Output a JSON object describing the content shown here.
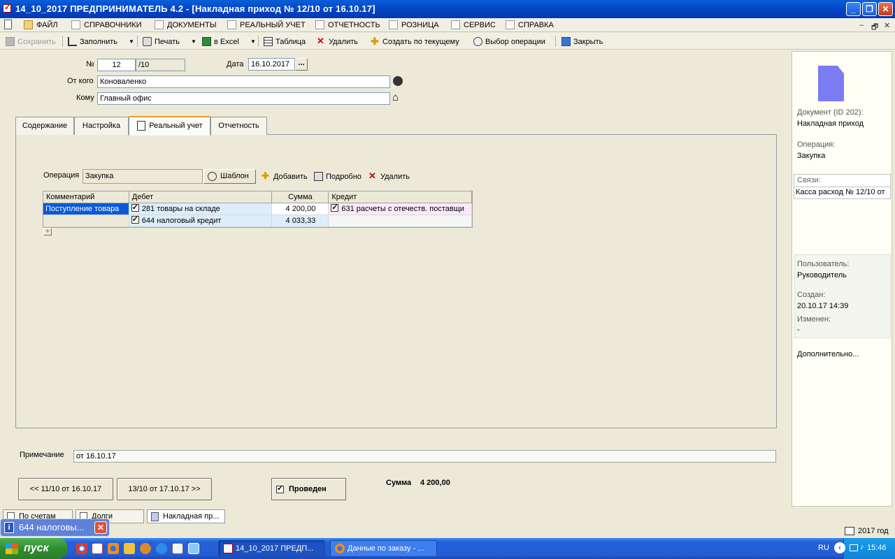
{
  "window": {
    "title": "14_10_2017  ПРЕДПРИНИМАТЕЛЬ 4.2 - [Накладная приход № 12/10 от 16.10.17]",
    "controls": {
      "minimize": "_",
      "maximize": "❐",
      "close": "✕"
    }
  },
  "menubar": {
    "items": [
      {
        "label": "ФАЙЛ",
        "icon": "folder-icon"
      },
      {
        "label": "СПРАВОЧНИКИ",
        "icon": "house-icon"
      },
      {
        "label": "ДОКУМЕНТЫ",
        "icon": "document-icon"
      },
      {
        "label": "РЕАЛЬНЫЙ УЧЕТ",
        "icon": "ledger-icon"
      },
      {
        "label": "ОТЧЕТНОСТЬ",
        "icon": "report-icon"
      },
      {
        "label": "РОЗНИЦА",
        "icon": "cash-register-icon"
      },
      {
        "label": "СЕРВИС",
        "icon": "service-icon"
      },
      {
        "label": "СПРАВКА",
        "icon": "help-icon"
      }
    ],
    "mdi_controls": {
      "minimize": "–",
      "restore": "🗗",
      "close": "✕"
    }
  },
  "toolbar": {
    "save": "Сохранить",
    "fill": "Заполнить",
    "print": "Печать",
    "excel": "в Excel",
    "table": "Таблица",
    "delete": "Удалить",
    "create_from_current": "Создать по текущему",
    "choose_operation": "Выбор операции",
    "close": "Закрыть"
  },
  "header_form": {
    "number_label": "№",
    "number_value": "12",
    "number_suffix": "/10",
    "date_label": "Дата",
    "date_value": "16.10.2017",
    "date_button": "...",
    "from_label": "От кого",
    "from_value": "Коноваленко",
    "to_label": "Кому",
    "to_value": "Главный офис"
  },
  "tabs": [
    {
      "label": "Содержание"
    },
    {
      "label": "Настройка"
    },
    {
      "label": "Реальный учет"
    },
    {
      "label": "Отчетность"
    }
  ],
  "operation_bar": {
    "label": "Операция",
    "value": "Закупка",
    "template_button": "Шаблон",
    "add_button": "Добавить",
    "details_button": "Подробно",
    "delete_button": "Удалить"
  },
  "entries_table": {
    "columns": [
      "Комментарий",
      "Дебет",
      "Сумма",
      "Кредит"
    ],
    "rows": [
      {
        "comment": "Поступление товара",
        "debit": "281 товары на складе",
        "amount": "4 200,00",
        "credit": "631  расчеты с  отечеств. поставщи"
      },
      {
        "comment": "",
        "debit": "644 налоговый кредит",
        "amount": "4 033,33",
        "credit": ""
      }
    ],
    "expand_button": "+"
  },
  "note": {
    "label": "Примечание",
    "value": "от 16.10.17"
  },
  "navigation": {
    "prev_button": "<< 11/10 от 16.10.17",
    "next_button": "13/10 от 17.10.17 >>"
  },
  "posted": {
    "label": "Проведен"
  },
  "total": {
    "label": "Сумма",
    "value": "4 200,00"
  },
  "right_panel": {
    "doc_label": "Документ  (ID 202):",
    "doc_value": "Накладная приход",
    "operation_label": "Операция:",
    "operation_value": "Закупка",
    "links_label": "Связи:",
    "links_value": "Касса расход № 12/10 от",
    "user_label": "Пользователь:",
    "user_value": "Руководитель",
    "created_label": "Создан:",
    "created_value": "20.10.17  14:39",
    "modified_label": "Изменен:",
    "modified_value": "-",
    "more": "Дополнительно..."
  },
  "window_tabs": [
    {
      "label": "По счетам"
    },
    {
      "label": "Долги"
    },
    {
      "label": "Накладная пр..."
    }
  ],
  "notification": {
    "text": "644 налоговы...",
    "close": "✕",
    "icon": "i"
  },
  "status": {
    "year": "2017 год"
  },
  "taskbar": {
    "start": "пуск",
    "tasks": [
      {
        "label": "14_10_2017  ПРЕДП..."
      },
      {
        "label": "Данные по заказу - ..."
      }
    ],
    "lang": "RU",
    "clock": "15:46"
  }
}
